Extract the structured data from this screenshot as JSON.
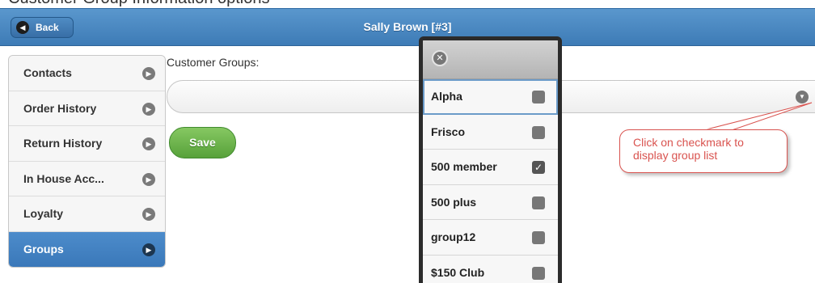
{
  "doc_heading": "Customer Group Information options",
  "header": {
    "back_label": "Back",
    "title": "Sally Brown [#3]"
  },
  "sidebar": {
    "items": [
      {
        "label": "Contacts",
        "active": false
      },
      {
        "label": "Order History",
        "active": false
      },
      {
        "label": "Return History",
        "active": false
      },
      {
        "label": "In House Acc...",
        "active": false
      },
      {
        "label": "Loyalty",
        "active": false
      },
      {
        "label": "Groups",
        "active": true
      }
    ]
  },
  "main": {
    "field_label": "Customer Groups:",
    "select_value": "",
    "save_label": "Save"
  },
  "popup": {
    "options": [
      {
        "label": "Alpha",
        "checked": false,
        "focused": true
      },
      {
        "label": "Frisco",
        "checked": false
      },
      {
        "label": "500 member",
        "checked": true
      },
      {
        "label": "500 plus",
        "checked": false
      },
      {
        "label": "group12",
        "checked": false
      },
      {
        "label": "$150 Club",
        "checked": false
      }
    ]
  },
  "callout": {
    "line1": "Click on checkmark to",
    "line2": "display group list"
  },
  "colors": {
    "header_blue": "#4a89c4",
    "save_green": "#6bb34a",
    "callout_red": "#d9534f"
  },
  "icons": {
    "back": "chevron-left-icon",
    "sidebar_chevron": "chevron-right-icon",
    "select_toggle": "chevron-down-icon",
    "popup_close": "close-icon",
    "option_checkbox": "checkbox-icon"
  }
}
